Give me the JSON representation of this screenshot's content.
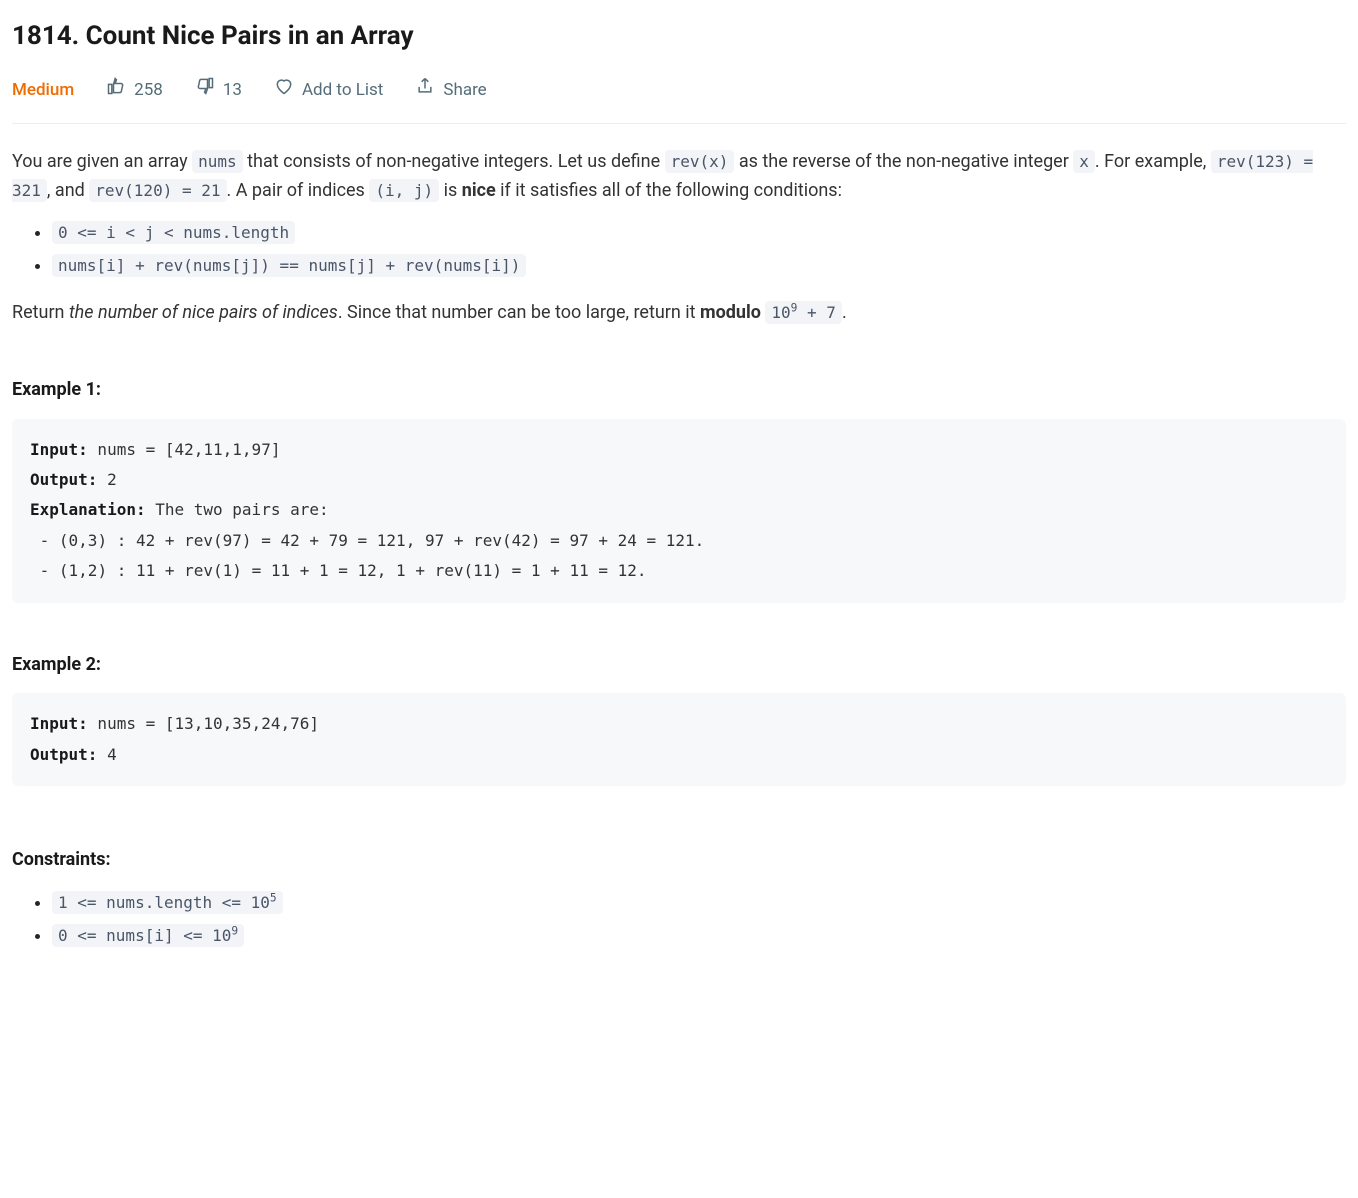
{
  "title": "1814. Count Nice Pairs in an Array",
  "difficulty": "Medium",
  "meta": {
    "likes": "258",
    "dislikes": "13",
    "add_to_list": "Add to List",
    "share": "Share"
  },
  "desc": {
    "p1_a": "You are given an array ",
    "c_nums": "nums",
    "p1_b": " that consists of non-negative integers. Let us define ",
    "c_revx": "rev(x)",
    "p1_c": " as the reverse of the non-negative integer ",
    "c_x": "x",
    "p1_d": ". For example, ",
    "c_rev123": "rev(123) = 321",
    "p1_e": ", and ",
    "c_rev120": "rev(120) = 21",
    "p1_f": ". A pair of indices ",
    "c_ij": "(i, j)",
    "p1_g": " is ",
    "b_nice": "nice",
    "p1_h": " if it satisfies all of the following conditions:",
    "cond1": "0 <= i < j < nums.length",
    "cond2": "nums[i] + rev(nums[j]) == nums[j] + rev(nums[i])",
    "p2_a": "Return ",
    "p2_em": "the number of nice pairs of indices",
    "p2_b": ". Since that number can be too large, return it ",
    "b_mod": "modulo",
    "p2_c": " ",
    "c_mod_base": "10",
    "c_mod_exp": "9",
    "c_mod_tail": " + 7",
    "p2_d": "."
  },
  "ex1": {
    "head": "Example 1:",
    "ln1_k": "Input:",
    "ln1_v": " nums = [42,11,1,97]",
    "ln2_k": "Output:",
    "ln2_v": " 2",
    "ln3_k": "Explanation:",
    "ln3_v": " The two pairs are:",
    "ln4": " - (0,3) : 42 + rev(97) = 42 + 79 = 121, 97 + rev(42) = 97 + 24 = 121.",
    "ln5": " - (1,2) : 11 + rev(1) = 11 + 1 = 12, 1 + rev(11) = 1 + 11 = 12."
  },
  "ex2": {
    "head": "Example 2:",
    "ln1_k": "Input:",
    "ln1_v": " nums = [13,10,35,24,76]",
    "ln2_k": "Output:",
    "ln2_v": " 4"
  },
  "constraints": {
    "head": "Constraints:",
    "c1_a": "1 <= nums.length <= 10",
    "c1_exp": "5",
    "c2_a": "0 <= nums[i] <= 10",
    "c2_exp": "9"
  }
}
